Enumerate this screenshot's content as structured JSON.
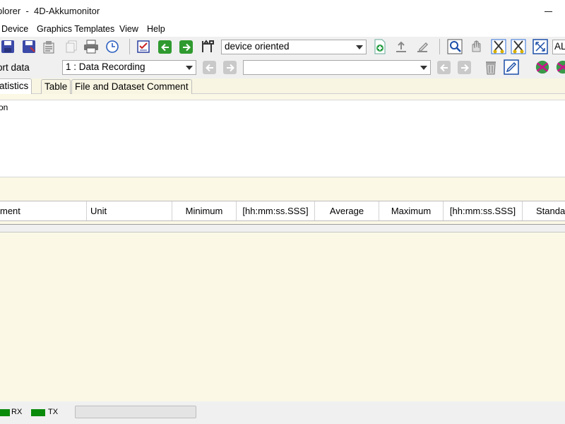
{
  "window": {
    "title": "plorer  -  4D-Akkumonitor"
  },
  "menu": [
    "Device",
    "Graphics Templates",
    "View",
    "Help"
  ],
  "toolbar": {
    "view_mode": "device oriented",
    "zoom_label": "AL"
  },
  "datasets": {
    "export_label": "ort data",
    "selected": "1 : Data Recording",
    "filter_value": ""
  },
  "tabs": [
    "atistics",
    "Table",
    "File and Dataset Comment"
  ],
  "info": {
    "text": "on"
  },
  "table": {
    "columns": [
      "ment",
      "Unit",
      "Minimum",
      "[hh:mm:ss.SSS]",
      "Average",
      "Maximum",
      "[hh:mm:ss.SSS]",
      "Standa"
    ]
  },
  "status": {
    "rx": "RX",
    "tx": "TX"
  },
  "colors": {
    "background": "#fbf8e6",
    "toolbar": "#f0f0f0",
    "led_green": "#0a8a0a",
    "nav_green": "#2f9a2f"
  }
}
